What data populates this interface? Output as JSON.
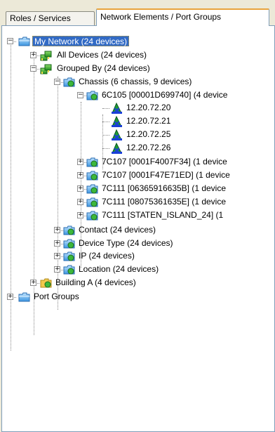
{
  "tabs": [
    {
      "label": "Roles / Services"
    },
    {
      "label": "Network Elements / Port Groups"
    }
  ],
  "tree": {
    "root": "My Network (24 devices)",
    "all_devices": "All Devices (24 devices)",
    "grouped_by": "Grouped By (24 devices)",
    "chassis": "Chassis (6 chassis, 9 devices)",
    "chassis_6c105": "6C105 [00001D699740] (4 device",
    "ips": [
      "12.20.72.20",
      "12.20.72.21",
      "12.20.72.25",
      "12.20.72.26"
    ],
    "chassis_items": [
      "7C107 [0001F4007F34] (1 device",
      "7C107 [0001F47E71ED] (1 device",
      "7C111 [06365916635B] (1 device",
      "7C111 [08075361635E] (1 device",
      "7C111 [STATEN_ISLAND_24] (1"
    ],
    "contact": "Contact (24 devices)",
    "device_type": "Device Type (24 devices)",
    "ip": "IP (24 devices)",
    "location": "Location (24 devices)",
    "building_a": "Building A (4 devices)",
    "port_groups": "Port Groups"
  }
}
